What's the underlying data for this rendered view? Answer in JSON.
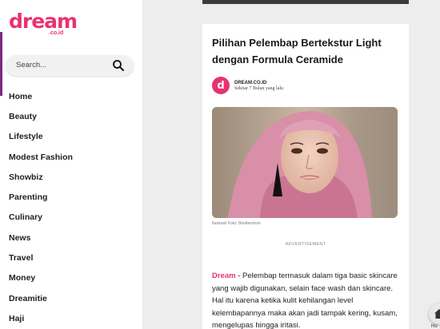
{
  "logo": {
    "word": "dream",
    "domain": ".co.id"
  },
  "search": {
    "placeholder": "Search..."
  },
  "nav": [
    "Home",
    "Beauty",
    "Lifestyle",
    "Modest Fashion",
    "Showbiz",
    "Parenting",
    "Culinary",
    "News",
    "Travel",
    "Money",
    "Dreamitie",
    "Haji"
  ],
  "article": {
    "title": "Pilihan Pelembap Bertekstur Light dengan Formula Ceramide",
    "author_initial": "d",
    "author": "DREAM.CO.ID",
    "time": "Sekitar 7 Bulan yang lalu",
    "caption": "Ilustrasi/ Foto: Shutterstock",
    "advertisement": "ADVERTISEMENT",
    "brand": "Dream",
    "body": " - Pelembap termasuk dalam tiga basic skincare yang wajib digunakan, selain face wash dan skincare. Hal itu karena ketika kulit kehilangan level kelembapannya maka akan jadi tampak kering, kusam, mengelupas hingga iritasi."
  },
  "fab": {
    "label": "Ho"
  },
  "colors": {
    "brand": "#e8336d",
    "sidebar_edge": "#7a2a82",
    "background": "#ededed"
  }
}
